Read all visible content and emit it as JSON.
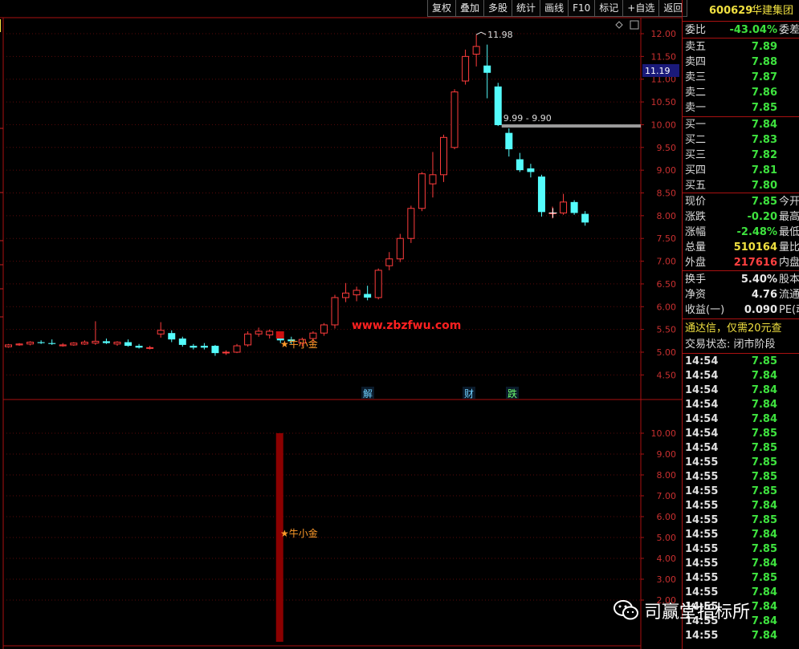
{
  "toolbar": {
    "buttons": [
      "复权",
      "叠加",
      "多股",
      "统计",
      "画线",
      "F10",
      "标记",
      "+自选",
      "返回"
    ]
  },
  "chart": {
    "y_labels": [
      "12.00",
      "11.50",
      "11.00",
      "10.50",
      "10.00",
      "9.50",
      "9.00",
      "8.50",
      "8.00",
      "7.50",
      "7.00",
      "6.50",
      "6.00",
      "5.50",
      "5.00",
      "4.50"
    ],
    "current_price_label": "11.19",
    "high_label": "11.98",
    "range_label": "9.99 - 9.90",
    "watermark_url": "www.zbzfwu.com",
    "star_label": "★牛小金",
    "event_labels": [
      "解",
      "财",
      "跌"
    ],
    "lower_y_labels": [
      "10.00",
      "9.00",
      "8.00",
      "7.00",
      "6.00",
      "5.00",
      "4.00",
      "3.00",
      "2.00"
    ],
    "lower_star_label": "★牛小金"
  },
  "chart_data": {
    "type": "candlestick",
    "price_range": [
      4.3,
      12.3
    ],
    "candles": [
      {
        "o": 5.12,
        "h": 5.18,
        "l": 5.1,
        "c": 5.16
      },
      {
        "o": 5.16,
        "h": 5.2,
        "l": 5.14,
        "c": 5.18
      },
      {
        "o": 5.18,
        "h": 5.24,
        "l": 5.15,
        "c": 5.22
      },
      {
        "o": 5.22,
        "h": 5.26,
        "l": 5.18,
        "c": 5.2
      },
      {
        "o": 5.2,
        "h": 5.28,
        "l": 5.16,
        "c": 5.18
      },
      {
        "o": 5.14,
        "h": 5.2,
        "l": 5.12,
        "c": 5.16
      },
      {
        "o": 5.16,
        "h": 5.22,
        "l": 5.14,
        "c": 5.2
      },
      {
        "o": 5.18,
        "h": 5.26,
        "l": 5.16,
        "c": 5.22
      },
      {
        "o": 5.2,
        "h": 5.68,
        "l": 5.16,
        "c": 5.24
      },
      {
        "o": 5.24,
        "h": 5.3,
        "l": 5.18,
        "c": 5.2
      },
      {
        "o": 5.18,
        "h": 5.24,
        "l": 5.14,
        "c": 5.22
      },
      {
        "o": 5.22,
        "h": 5.28,
        "l": 5.12,
        "c": 5.14
      },
      {
        "o": 5.14,
        "h": 5.18,
        "l": 5.08,
        "c": 5.1
      },
      {
        "o": 5.1,
        "h": 5.14,
        "l": 5.06,
        "c": 5.1
      },
      {
        "o": 5.4,
        "h": 5.66,
        "l": 5.32,
        "c": 5.48
      },
      {
        "o": 5.42,
        "h": 5.48,
        "l": 5.22,
        "c": 5.28
      },
      {
        "o": 5.3,
        "h": 5.34,
        "l": 5.12,
        "c": 5.16
      },
      {
        "o": 5.14,
        "h": 5.18,
        "l": 5.06,
        "c": 5.1
      },
      {
        "o": 5.14,
        "h": 5.2,
        "l": 5.06,
        "c": 5.1
      },
      {
        "o": 5.14,
        "h": 5.16,
        "l": 4.92,
        "c": 4.98
      },
      {
        "o": 5.0,
        "h": 5.04,
        "l": 4.94,
        "c": 5.0
      },
      {
        "o": 5.0,
        "h": 5.18,
        "l": 4.98,
        "c": 5.14
      },
      {
        "o": 5.16,
        "h": 5.46,
        "l": 5.12,
        "c": 5.4
      },
      {
        "o": 5.4,
        "h": 5.54,
        "l": 5.34,
        "c": 5.46
      },
      {
        "o": 5.38,
        "h": 5.5,
        "l": 5.3,
        "c": 5.46
      },
      {
        "o": 5.3,
        "h": 5.36,
        "l": 5.2,
        "c": 5.26
      },
      {
        "o": 5.28,
        "h": 5.34,
        "l": 5.18,
        "c": 5.24
      },
      {
        "o": 5.2,
        "h": 5.32,
        "l": 5.12,
        "c": 5.28
      },
      {
        "o": 5.3,
        "h": 5.46,
        "l": 5.22,
        "c": 5.42
      },
      {
        "o": 5.42,
        "h": 5.64,
        "l": 5.36,
        "c": 5.6
      },
      {
        "o": 5.6,
        "h": 6.26,
        "l": 5.52,
        "c": 6.2
      },
      {
        "o": 6.2,
        "h": 6.52,
        "l": 6.1,
        "c": 6.3
      },
      {
        "o": 6.26,
        "h": 6.44,
        "l": 6.12,
        "c": 6.36
      },
      {
        "o": 6.28,
        "h": 6.46,
        "l": 6.14,
        "c": 6.2
      },
      {
        "o": 6.2,
        "h": 6.84,
        "l": 6.16,
        "c": 6.8
      },
      {
        "o": 6.9,
        "h": 7.2,
        "l": 6.8,
        "c": 7.05
      },
      {
        "o": 7.05,
        "h": 7.6,
        "l": 6.98,
        "c": 7.5
      },
      {
        "o": 7.5,
        "h": 8.22,
        "l": 7.4,
        "c": 8.16
      },
      {
        "o": 8.16,
        "h": 8.96,
        "l": 8.1,
        "c": 8.92
      },
      {
        "o": 8.7,
        "h": 9.4,
        "l": 8.4,
        "c": 8.9
      },
      {
        "o": 8.9,
        "h": 9.78,
        "l": 8.74,
        "c": 9.72
      },
      {
        "o": 9.5,
        "h": 10.78,
        "l": 9.46,
        "c": 10.72
      },
      {
        "o": 10.96,
        "h": 11.65,
        "l": 10.88,
        "c": 11.5
      },
      {
        "o": 11.55,
        "h": 11.98,
        "l": 11.28,
        "c": 11.72
      },
      {
        "o": 11.3,
        "h": 11.76,
        "l": 10.58,
        "c": 11.14
      },
      {
        "o": 10.84,
        "h": 10.92,
        "l": 9.97,
        "c": 9.99
      },
      {
        "o": 9.82,
        "h": 9.92,
        "l": 9.3,
        "c": 9.46
      },
      {
        "o": 9.24,
        "h": 9.38,
        "l": 8.96,
        "c": 9.0
      },
      {
        "o": 9.04,
        "h": 9.14,
        "l": 8.84,
        "c": 8.96
      },
      {
        "o": 8.86,
        "h": 8.9,
        "l": 7.98,
        "c": 8.08
      },
      {
        "o": 8.06,
        "h": 8.2,
        "l": 7.94,
        "c": 8.06
      },
      {
        "o": 8.06,
        "h": 8.48,
        "l": 8.02,
        "c": 8.3
      },
      {
        "o": 8.3,
        "h": 8.34,
        "l": 8.02,
        "c": 8.06
      },
      {
        "o": 8.04,
        "h": 8.1,
        "l": 7.78,
        "c": 7.85
      }
    ],
    "lower_indicator": {
      "type": "bar",
      "value": 10.0,
      "candle_index": 25,
      "y_range": [
        1.2,
        10.5
      ]
    }
  },
  "side": {
    "code": "600629",
    "name": "华建集团",
    "webi_label": "委比",
    "webi_value": "-43.04%",
    "webi_ext": "委差",
    "asks": [
      {
        "label": "卖五",
        "price": "7.89"
      },
      {
        "label": "卖四",
        "price": "7.88"
      },
      {
        "label": "卖三",
        "price": "7.87"
      },
      {
        "label": "卖二",
        "price": "7.86"
      },
      {
        "label": "卖一",
        "price": "7.85"
      }
    ],
    "bids": [
      {
        "label": "买一",
        "price": "7.84"
      },
      {
        "label": "买二",
        "price": "7.83"
      },
      {
        "label": "买三",
        "price": "7.82"
      },
      {
        "label": "买四",
        "price": "7.81"
      },
      {
        "label": "买五",
        "price": "7.80"
      }
    ],
    "quote": [
      {
        "label": "现价",
        "value": "7.85",
        "ext": "今开",
        "color": "green"
      },
      {
        "label": "涨跌",
        "value": "-0.20",
        "ext": "最高",
        "color": "green"
      },
      {
        "label": "涨幅",
        "value": "-2.48%",
        "ext": "最低",
        "color": "green"
      },
      {
        "label": "总量",
        "value": "510164",
        "ext": "量比",
        "color": "yellow"
      },
      {
        "label": "外盘",
        "value": "217616",
        "ext": "内盘",
        "color": "red"
      }
    ],
    "fund": [
      {
        "label": "换手",
        "value": "5.40%",
        "ext": "股本"
      },
      {
        "label": "净资",
        "value": "4.76",
        "ext": "流通"
      },
      {
        "label": "收益(一)",
        "value": "0.090",
        "ext": "PE(动"
      }
    ],
    "notice": "通达信，仅需20元查",
    "trade_status": "交易状态: 闭市阶段",
    "ticks": [
      {
        "t": "14:54",
        "p": "7.85"
      },
      {
        "t": "14:54",
        "p": "7.84"
      },
      {
        "t": "14:54",
        "p": "7.84"
      },
      {
        "t": "14:54",
        "p": "7.84"
      },
      {
        "t": "14:54",
        "p": "7.84"
      },
      {
        "t": "14:54",
        "p": "7.85"
      },
      {
        "t": "14:54",
        "p": "7.85"
      },
      {
        "t": "14:55",
        "p": "7.85"
      },
      {
        "t": "14:55",
        "p": "7.85"
      },
      {
        "t": "14:55",
        "p": "7.85"
      },
      {
        "t": "14:55",
        "p": "7.84"
      },
      {
        "t": "14:55",
        "p": "7.85"
      },
      {
        "t": "14:55",
        "p": "7.84"
      },
      {
        "t": "14:55",
        "p": "7.85"
      },
      {
        "t": "14:55",
        "p": "7.84"
      },
      {
        "t": "14:55",
        "p": "7.85"
      },
      {
        "t": "14:55",
        "p": "7.84"
      },
      {
        "t": "14:55",
        "p": "7.84"
      },
      {
        "t": "14:55",
        "p": "7.84"
      },
      {
        "t": "14:55",
        "p": "7.84"
      }
    ]
  },
  "watermark": {
    "text": "司赢堂指标所"
  }
}
